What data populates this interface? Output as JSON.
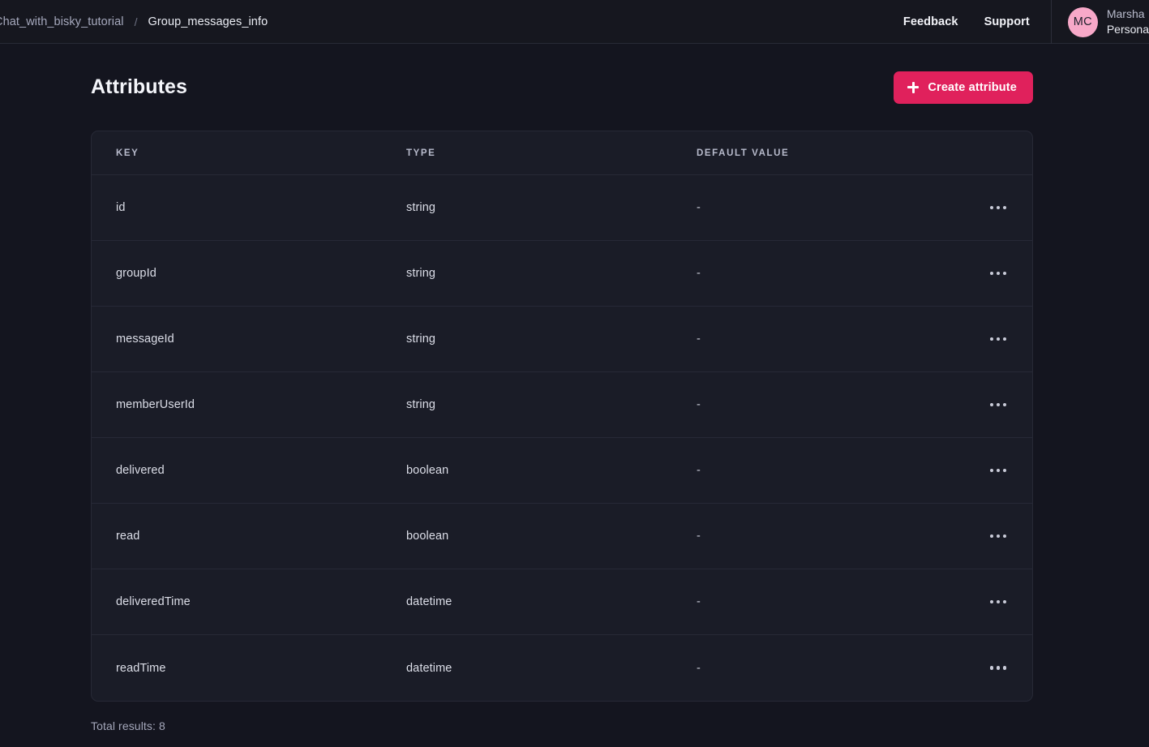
{
  "topbar": {
    "breadcrumb": {
      "parent": "Chat_with_bisky_tutorial",
      "separator": "/",
      "current": "Group_messages_info"
    },
    "links": [
      {
        "label": "Feedback",
        "name": "feedback-link"
      },
      {
        "label": "Support",
        "name": "support-link"
      }
    ],
    "user": {
      "initials": "MC",
      "name": "Marsha",
      "org": "Persona",
      "avatar_color": "#f7a8c8"
    }
  },
  "page": {
    "title": "Attributes",
    "create_button": {
      "label": "Create attribute",
      "icon": "plus-icon",
      "color": "#e0215c"
    }
  },
  "table": {
    "columns": [
      "KEY",
      "TYPE",
      "DEFAULT VALUE"
    ],
    "rows": [
      {
        "key": "id",
        "type": "string",
        "default": "-"
      },
      {
        "key": "groupId",
        "type": "string",
        "default": "-"
      },
      {
        "key": "messageId",
        "type": "string",
        "default": "-"
      },
      {
        "key": "memberUserId",
        "type": "string",
        "default": "-"
      },
      {
        "key": "delivered",
        "type": "boolean",
        "default": "-"
      },
      {
        "key": "read",
        "type": "boolean",
        "default": "-"
      },
      {
        "key": "deliveredTime",
        "type": "datetime",
        "default": "-"
      },
      {
        "key": "readTime",
        "type": "datetime",
        "default": "-"
      }
    ],
    "row_menu_icon": "more-horizontal-icon",
    "total_results": "Total results: 8"
  }
}
